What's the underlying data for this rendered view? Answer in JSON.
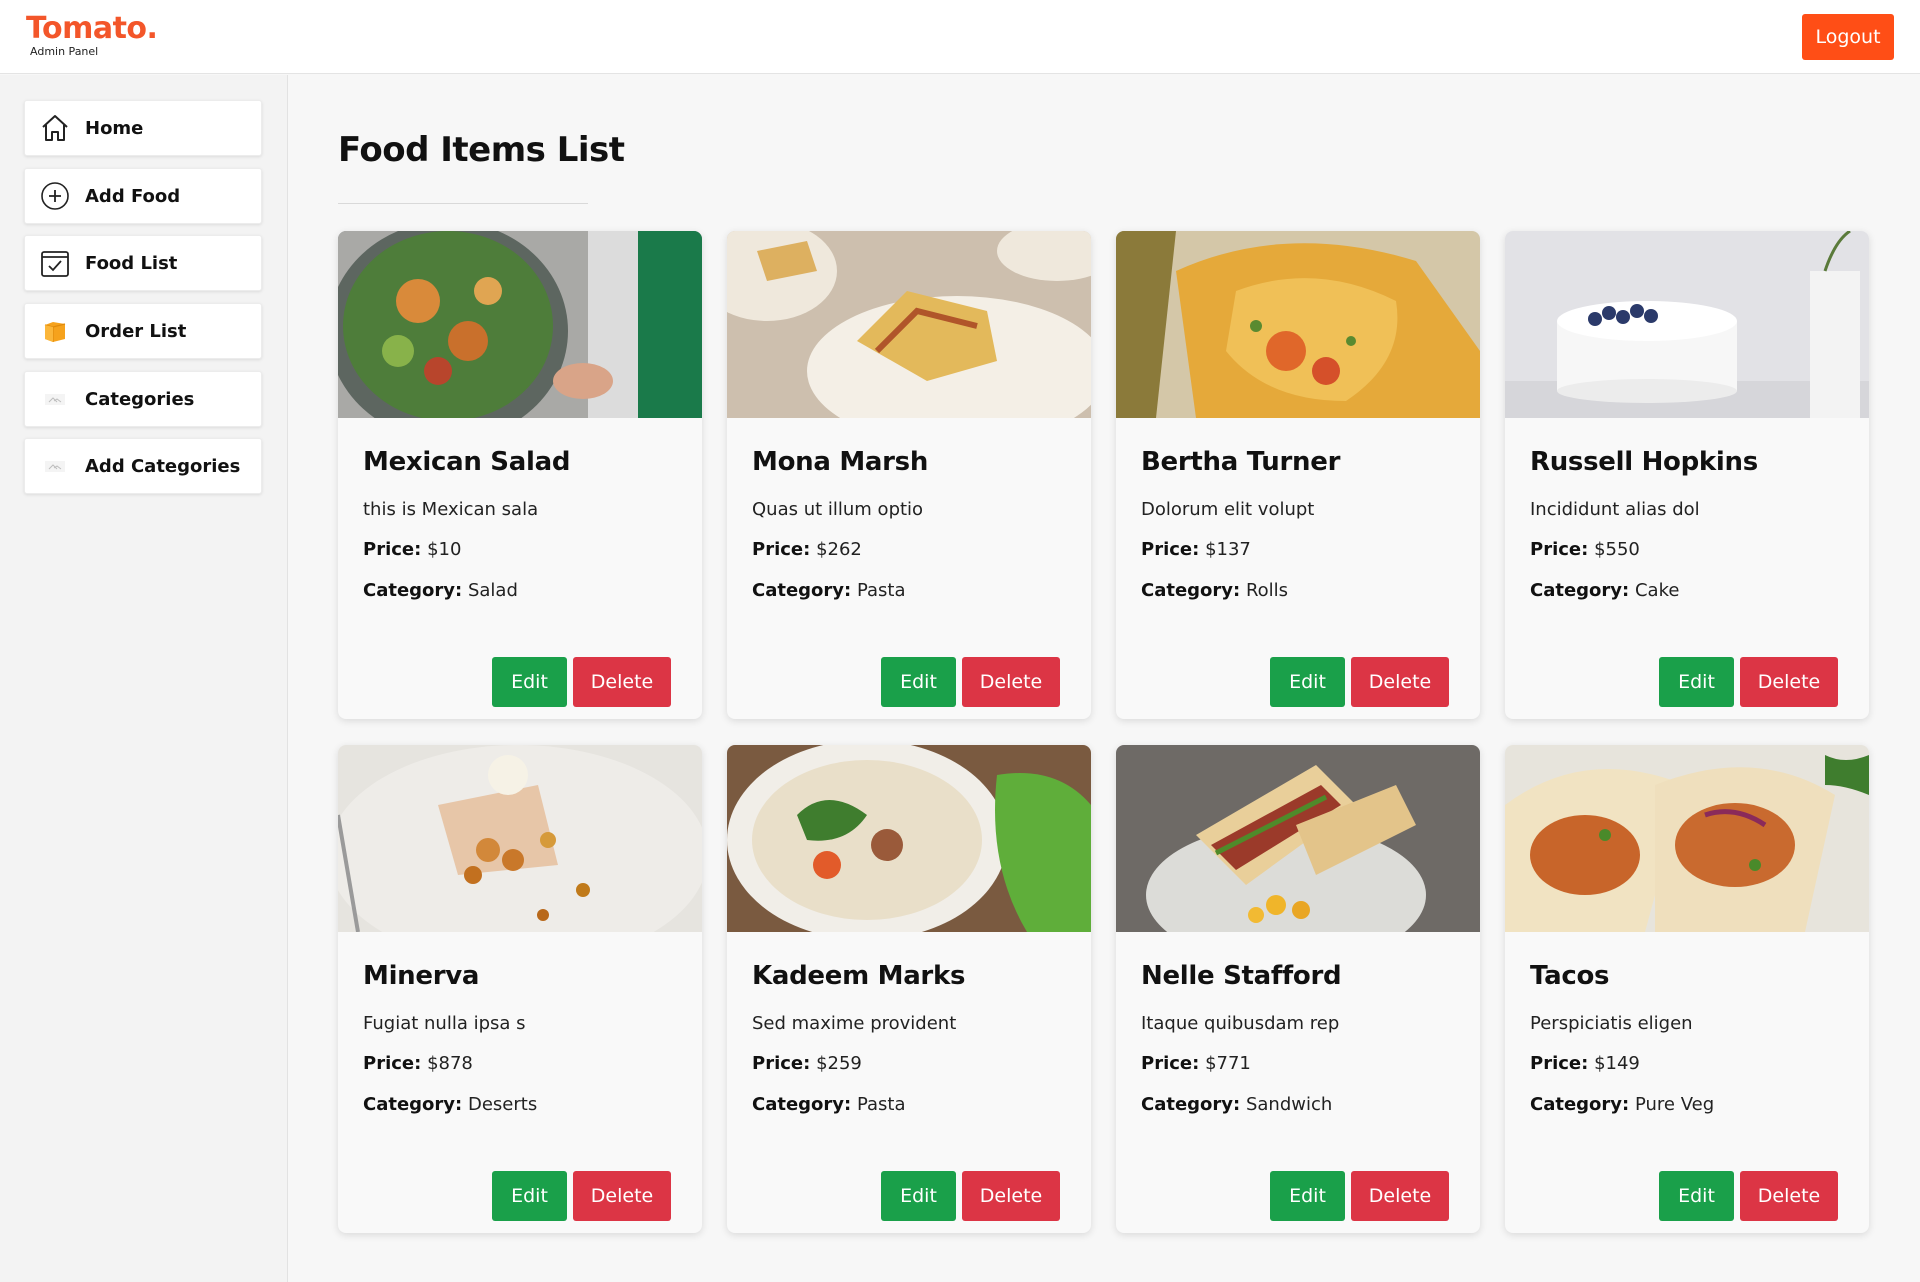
{
  "brand": {
    "name": "Tomato.",
    "subtitle": "Admin Panel",
    "color": "#f3562a"
  },
  "header": {
    "logout_label": "Logout"
  },
  "sidebar": {
    "items": [
      {
        "label": "Home",
        "icon": "home-icon"
      },
      {
        "label": "Add Food",
        "icon": "plus-circle-icon"
      },
      {
        "label": "Food List",
        "icon": "checklist-icon"
      },
      {
        "label": "Order List",
        "icon": "parcel-box-icon"
      },
      {
        "label": "Categories",
        "icon": "category-thumbnail-icon"
      },
      {
        "label": "Add Categories",
        "icon": "category-thumbnail-icon"
      }
    ]
  },
  "main": {
    "title": "Food Items List",
    "price_label": "Price:",
    "category_label": "Category:",
    "edit_label": "Edit",
    "delete_label": "Delete",
    "items": [
      {
        "name": "Mexican Salad",
        "description": "this is Mexican sala",
        "price": "$10",
        "category": "Salad",
        "image": "salad-photo"
      },
      {
        "name": "Mona Marsh",
        "description": "Quas ut illum optio",
        "price": "$262",
        "category": "Pasta",
        "image": "lasagna-photo"
      },
      {
        "name": "Bertha Turner",
        "description": "Dolorum elit volupt",
        "price": "$137",
        "category": "Rolls",
        "image": "rolls-photo"
      },
      {
        "name": "Russell Hopkins",
        "description": "Incididunt alias dol",
        "price": "$550",
        "category": "Cake",
        "image": "cake-photo"
      },
      {
        "name": "Minerva",
        "description": "Fugiat nulla ipsa s",
        "price": "$878",
        "category": "Deserts",
        "image": "dessert-photo"
      },
      {
        "name": "Kadeem Marks",
        "description": "Sed maxime provident",
        "price": "$259",
        "category": "Pasta",
        "image": "noodle-soup-photo"
      },
      {
        "name": "Nelle Stafford",
        "description": "Itaque quibusdam rep",
        "price": "$771",
        "category": "Sandwich",
        "image": "sandwich-photo"
      },
      {
        "name": "Tacos",
        "description": "Perspiciatis eligen",
        "price": "$149",
        "category": "Pure Veg",
        "image": "tacos-photo"
      }
    ]
  },
  "colors": {
    "accent": "#ff4e16",
    "edit": "#1aa04a",
    "delete": "#dc3545"
  }
}
